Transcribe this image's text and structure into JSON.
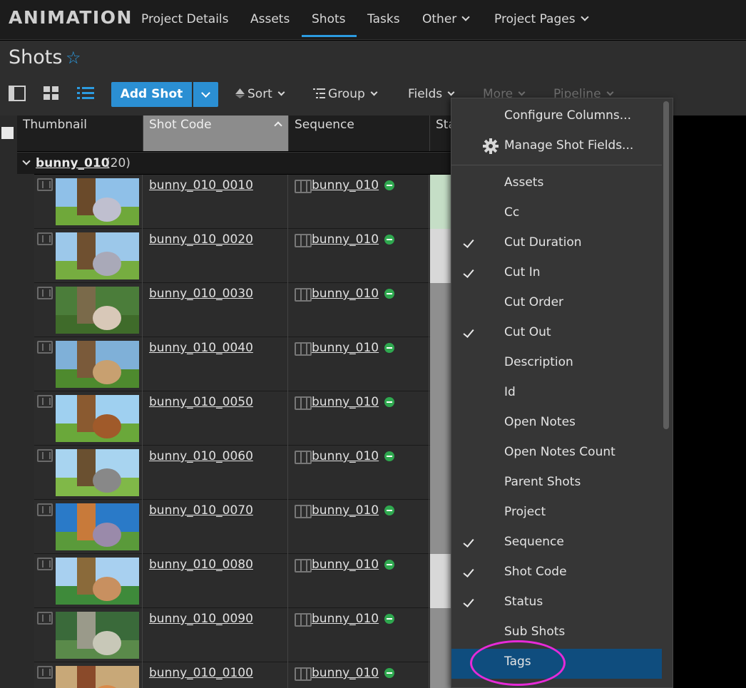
{
  "nav": {
    "brand": "ANIMATION",
    "items": [
      "Project Details",
      "Assets",
      "Shots",
      "Tasks",
      "Other",
      "Project Pages"
    ],
    "active": "Shots",
    "accent": "#2c9be0"
  },
  "page": {
    "title": "Shots",
    "favorite_icon": "star-outline-icon"
  },
  "toolbar": {
    "view_icons": [
      "detail-panel-icon",
      "grid-view-icon",
      "list-view-icon"
    ],
    "add_label": "Add Shot",
    "sort_label": "Sort",
    "group_label": "Group",
    "fields_label": "Fields",
    "more_label": "More",
    "pipeline_label": "Pipeline"
  },
  "columns": {
    "thumbnail": "Thumbnail",
    "shot_code": "Shot Code",
    "sequence": "Sequence",
    "status": "Sta"
  },
  "group": {
    "name": "bunny_010",
    "count": "(20)"
  },
  "rows": [
    {
      "code": "bunny_010_0010",
      "sequence": "bunny_010",
      "status_color": "#c5dec6"
    },
    {
      "code": "bunny_010_0020",
      "sequence": "bunny_010",
      "status_color": "#d8d8d8"
    },
    {
      "code": "bunny_010_0030",
      "sequence": "bunny_010",
      "status_color": "#8f8f8f"
    },
    {
      "code": "bunny_010_0040",
      "sequence": "bunny_010",
      "status_color": "#8f8f8f"
    },
    {
      "code": "bunny_010_0050",
      "sequence": "bunny_010",
      "status_color": "#8f8f8f"
    },
    {
      "code": "bunny_010_0060",
      "sequence": "bunny_010",
      "status_color": "#8f8f8f"
    },
    {
      "code": "bunny_010_0070",
      "sequence": "bunny_010",
      "status_color": "#8f8f8f"
    },
    {
      "code": "bunny_010_0080",
      "sequence": "bunny_010",
      "status_color": "#d8d8d8"
    },
    {
      "code": "bunny_010_0090",
      "sequence": "bunny_010",
      "status_color": "#8f8f8f"
    },
    {
      "code": "bunny_010_0100",
      "sequence": "bunny_010",
      "status_color": "#8f8f8f"
    }
  ],
  "fields_menu": {
    "configure": "Configure Columns...",
    "manage": "Manage Shot Fields...",
    "fields": [
      {
        "label": "Assets",
        "checked": false
      },
      {
        "label": "Cc",
        "checked": false
      },
      {
        "label": "Cut Duration",
        "checked": true
      },
      {
        "label": "Cut In",
        "checked": true
      },
      {
        "label": "Cut Order",
        "checked": false
      },
      {
        "label": "Cut Out",
        "checked": true
      },
      {
        "label": "Description",
        "checked": false
      },
      {
        "label": "Id",
        "checked": false
      },
      {
        "label": "Open Notes",
        "checked": false
      },
      {
        "label": "Open Notes Count",
        "checked": false
      },
      {
        "label": "Parent Shots",
        "checked": false
      },
      {
        "label": "Project",
        "checked": false
      },
      {
        "label": "Sequence",
        "checked": true
      },
      {
        "label": "Shot Code",
        "checked": true
      },
      {
        "label": "Status",
        "checked": true
      },
      {
        "label": "Sub Shots",
        "checked": false
      },
      {
        "label": "Tags",
        "checked": false,
        "selected": true
      }
    ],
    "highlight_color": "#e62ad8"
  }
}
